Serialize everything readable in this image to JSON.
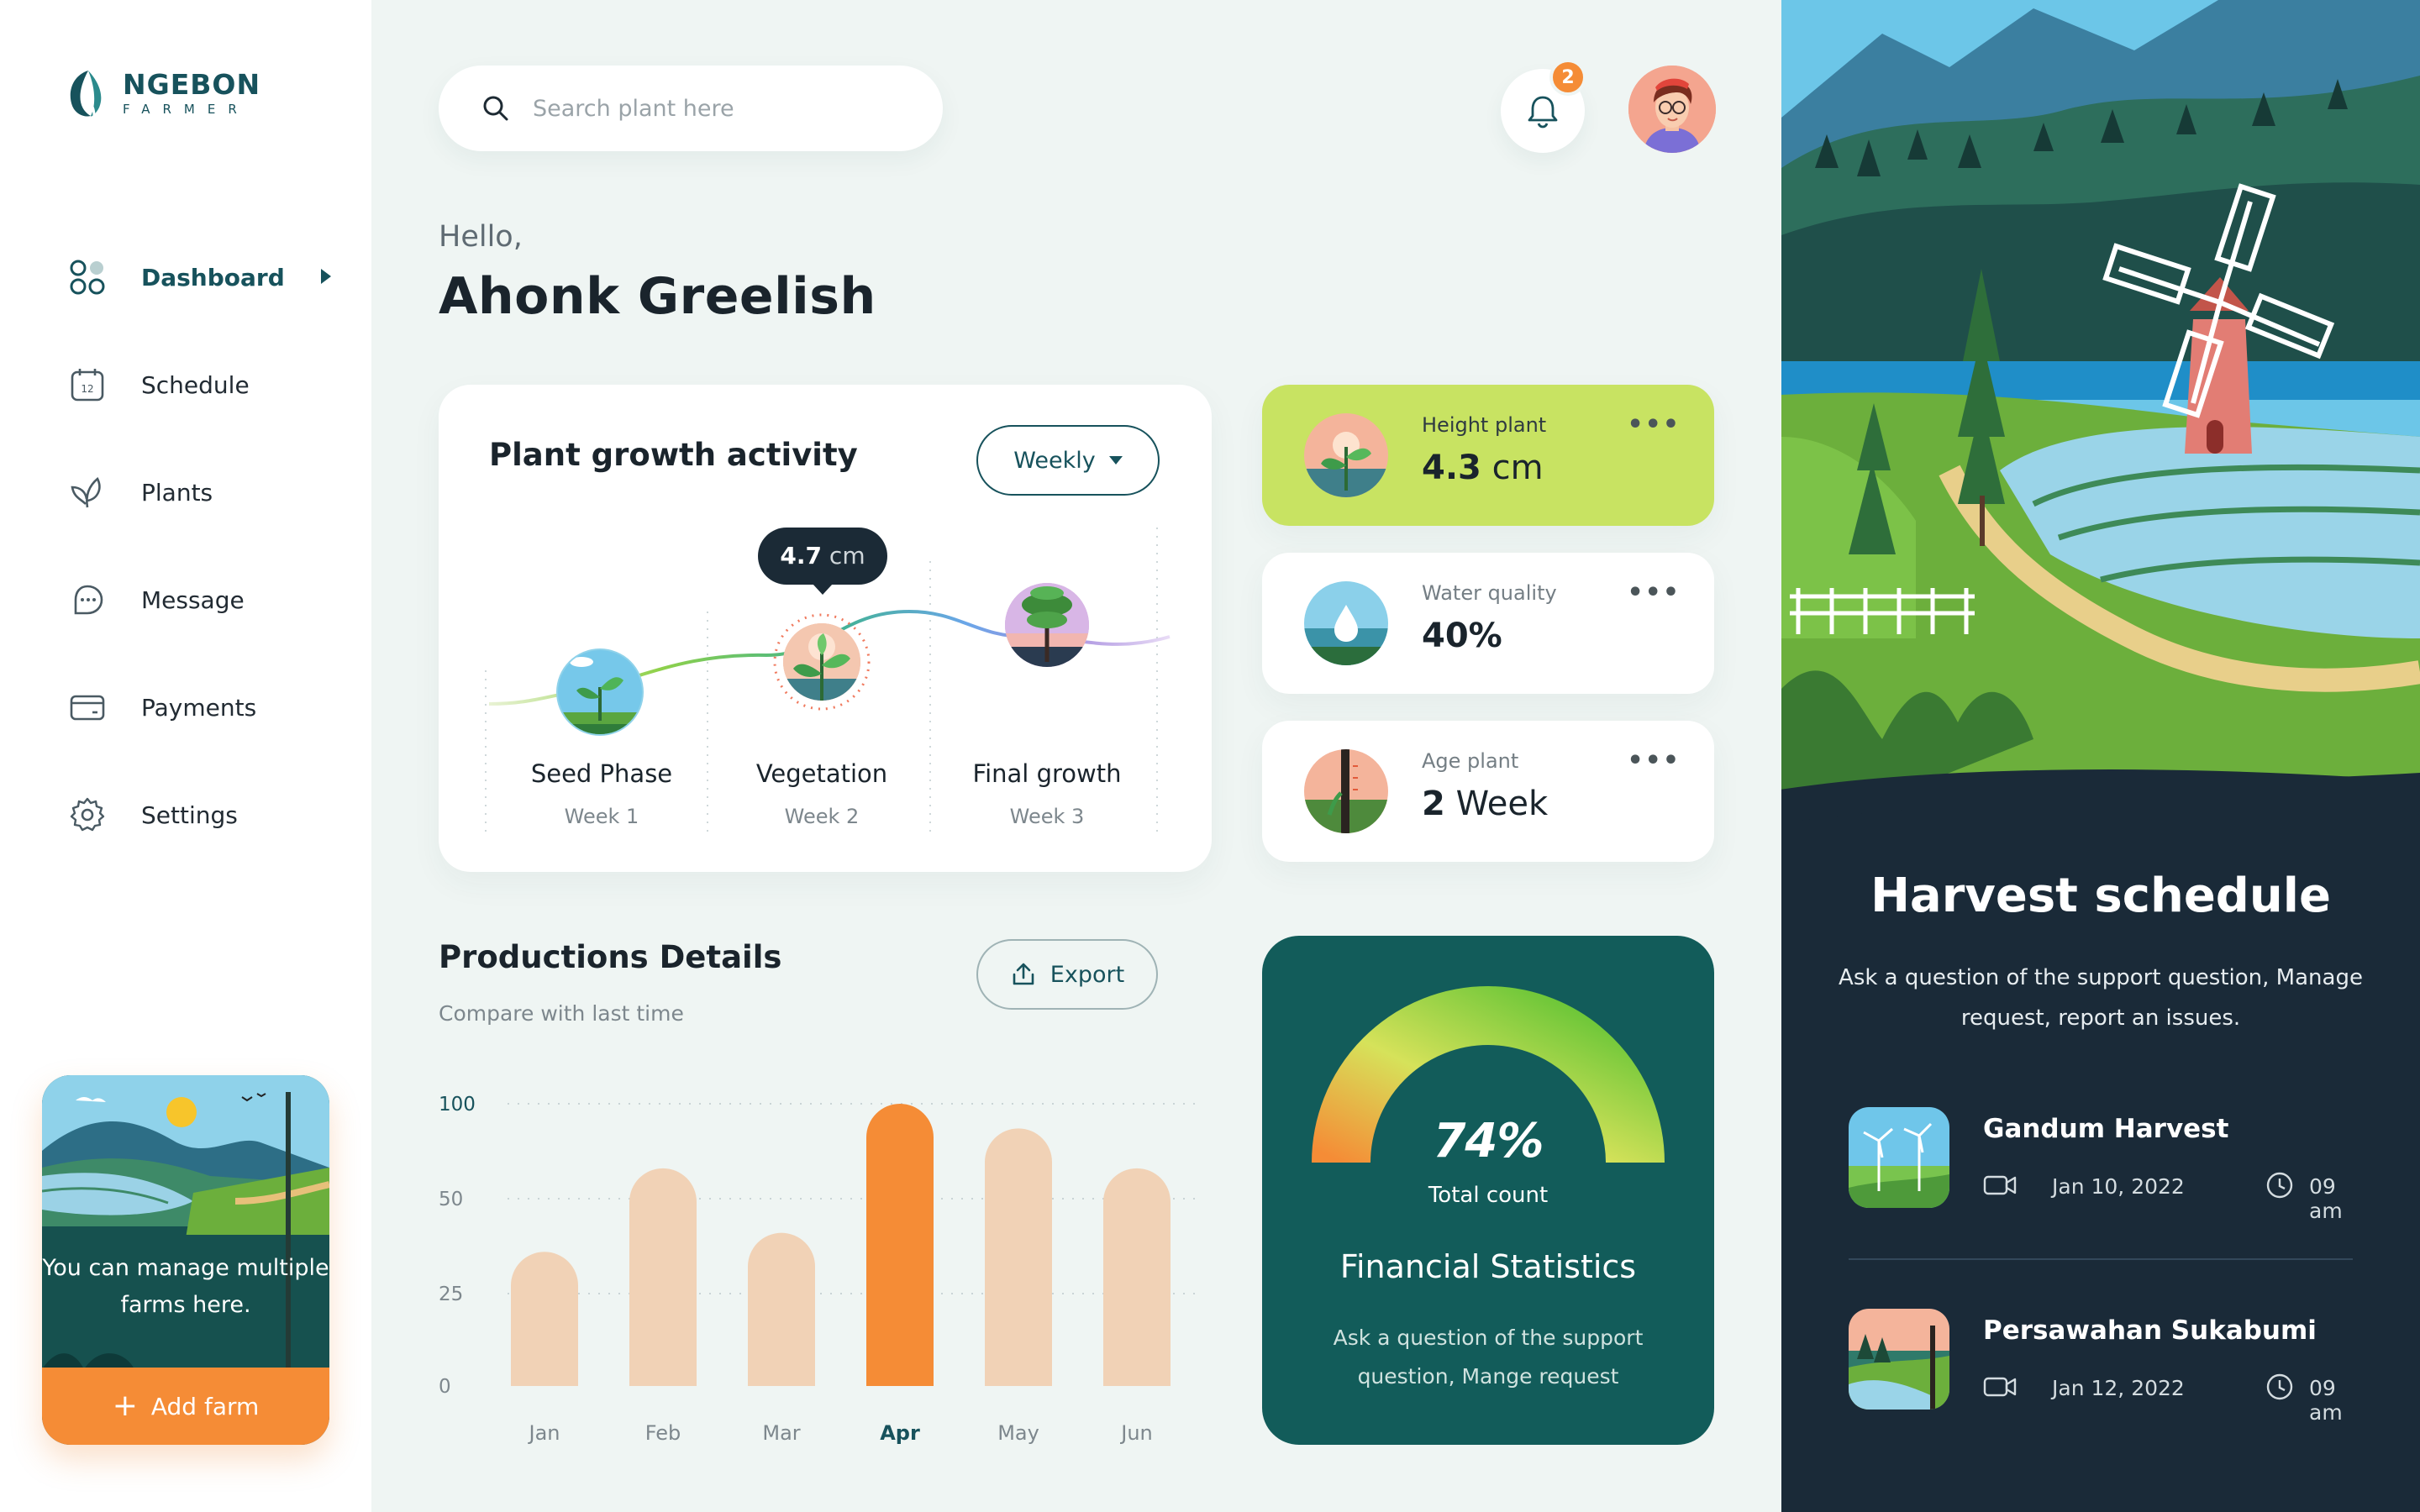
{
  "brand": {
    "name": "NGEBON",
    "tagline": "FARMER",
    "color": "#17525c"
  },
  "nav": {
    "items": [
      {
        "label": "Dashboard",
        "icon": "dashboard-icon",
        "active": true
      },
      {
        "label": "Schedule",
        "icon": "calendar-icon",
        "active": false
      },
      {
        "label": "Plants",
        "icon": "leaf-icon",
        "active": false
      },
      {
        "label": "Message",
        "icon": "chat-icon",
        "active": false
      },
      {
        "label": "Payments",
        "icon": "credit-card-icon",
        "active": false
      },
      {
        "label": "Settings",
        "icon": "gear-icon",
        "active": false
      }
    ]
  },
  "farm_card": {
    "text": "You can manage multiple farms here.",
    "button_label": "Add farm"
  },
  "search": {
    "placeholder": "Search plant here",
    "value": ""
  },
  "notifications": {
    "count": "2"
  },
  "greeting": {
    "hello": "Hello,",
    "name": "Ahonk Greelish"
  },
  "growth": {
    "title": "Plant growth activity",
    "period": "Weekly",
    "tooltip_value": "4.7",
    "tooltip_unit": "cm",
    "phases": [
      {
        "name": "Seed Phase",
        "week": "Week 1"
      },
      {
        "name": "Vegetation",
        "week": "Week 2"
      },
      {
        "name": "Final growth",
        "week": "Week 3"
      }
    ]
  },
  "stats": [
    {
      "label": "Height plant",
      "value": "4.3",
      "unit": "cm",
      "more": "•••"
    },
    {
      "label": "Water quality",
      "value": "40%",
      "unit": "",
      "more": "•••"
    },
    {
      "label": "Age plant",
      "value": "2",
      "unit": "Week",
      "more": "•••"
    }
  ],
  "production": {
    "title": "Productions Details",
    "subtitle": "Compare with last time",
    "export_label": "Export"
  },
  "chart_data": {
    "type": "bar",
    "categories": [
      "Jan",
      "Feb",
      "Mar",
      "Apr",
      "May",
      "Jun"
    ],
    "values": [
      36,
      66,
      41,
      100,
      87,
      66
    ],
    "highlight": "Apr",
    "yticks": [
      "100",
      "50",
      "25",
      "0"
    ],
    "ylim": [
      0,
      100
    ],
    "bar_color": "#f1d2b6",
    "highlight_color": "#f58c36",
    "grid": true
  },
  "financial": {
    "percent": "74%",
    "percent_value": 0.74,
    "count_label": "Total count",
    "title": "Financial Statistics",
    "description": "Ask a question of the support question, Mange request"
  },
  "harvest": {
    "title": "Harvest schedule",
    "description": "Ask a question of the support question, Manage request, report an issues.",
    "items": [
      {
        "name": "Gandum Harvest",
        "date": "Jan 10, 2022",
        "time": "09 am"
      },
      {
        "name": "Persawahan Sukabumi",
        "date": "Jan 12, 2022",
        "time": "09 am"
      }
    ]
  },
  "colors": {
    "accent": "#f58c36",
    "primary": "#17525c",
    "lime": "#c8e362",
    "dark": "#1a2a38",
    "teal_card": "#125c5a"
  }
}
